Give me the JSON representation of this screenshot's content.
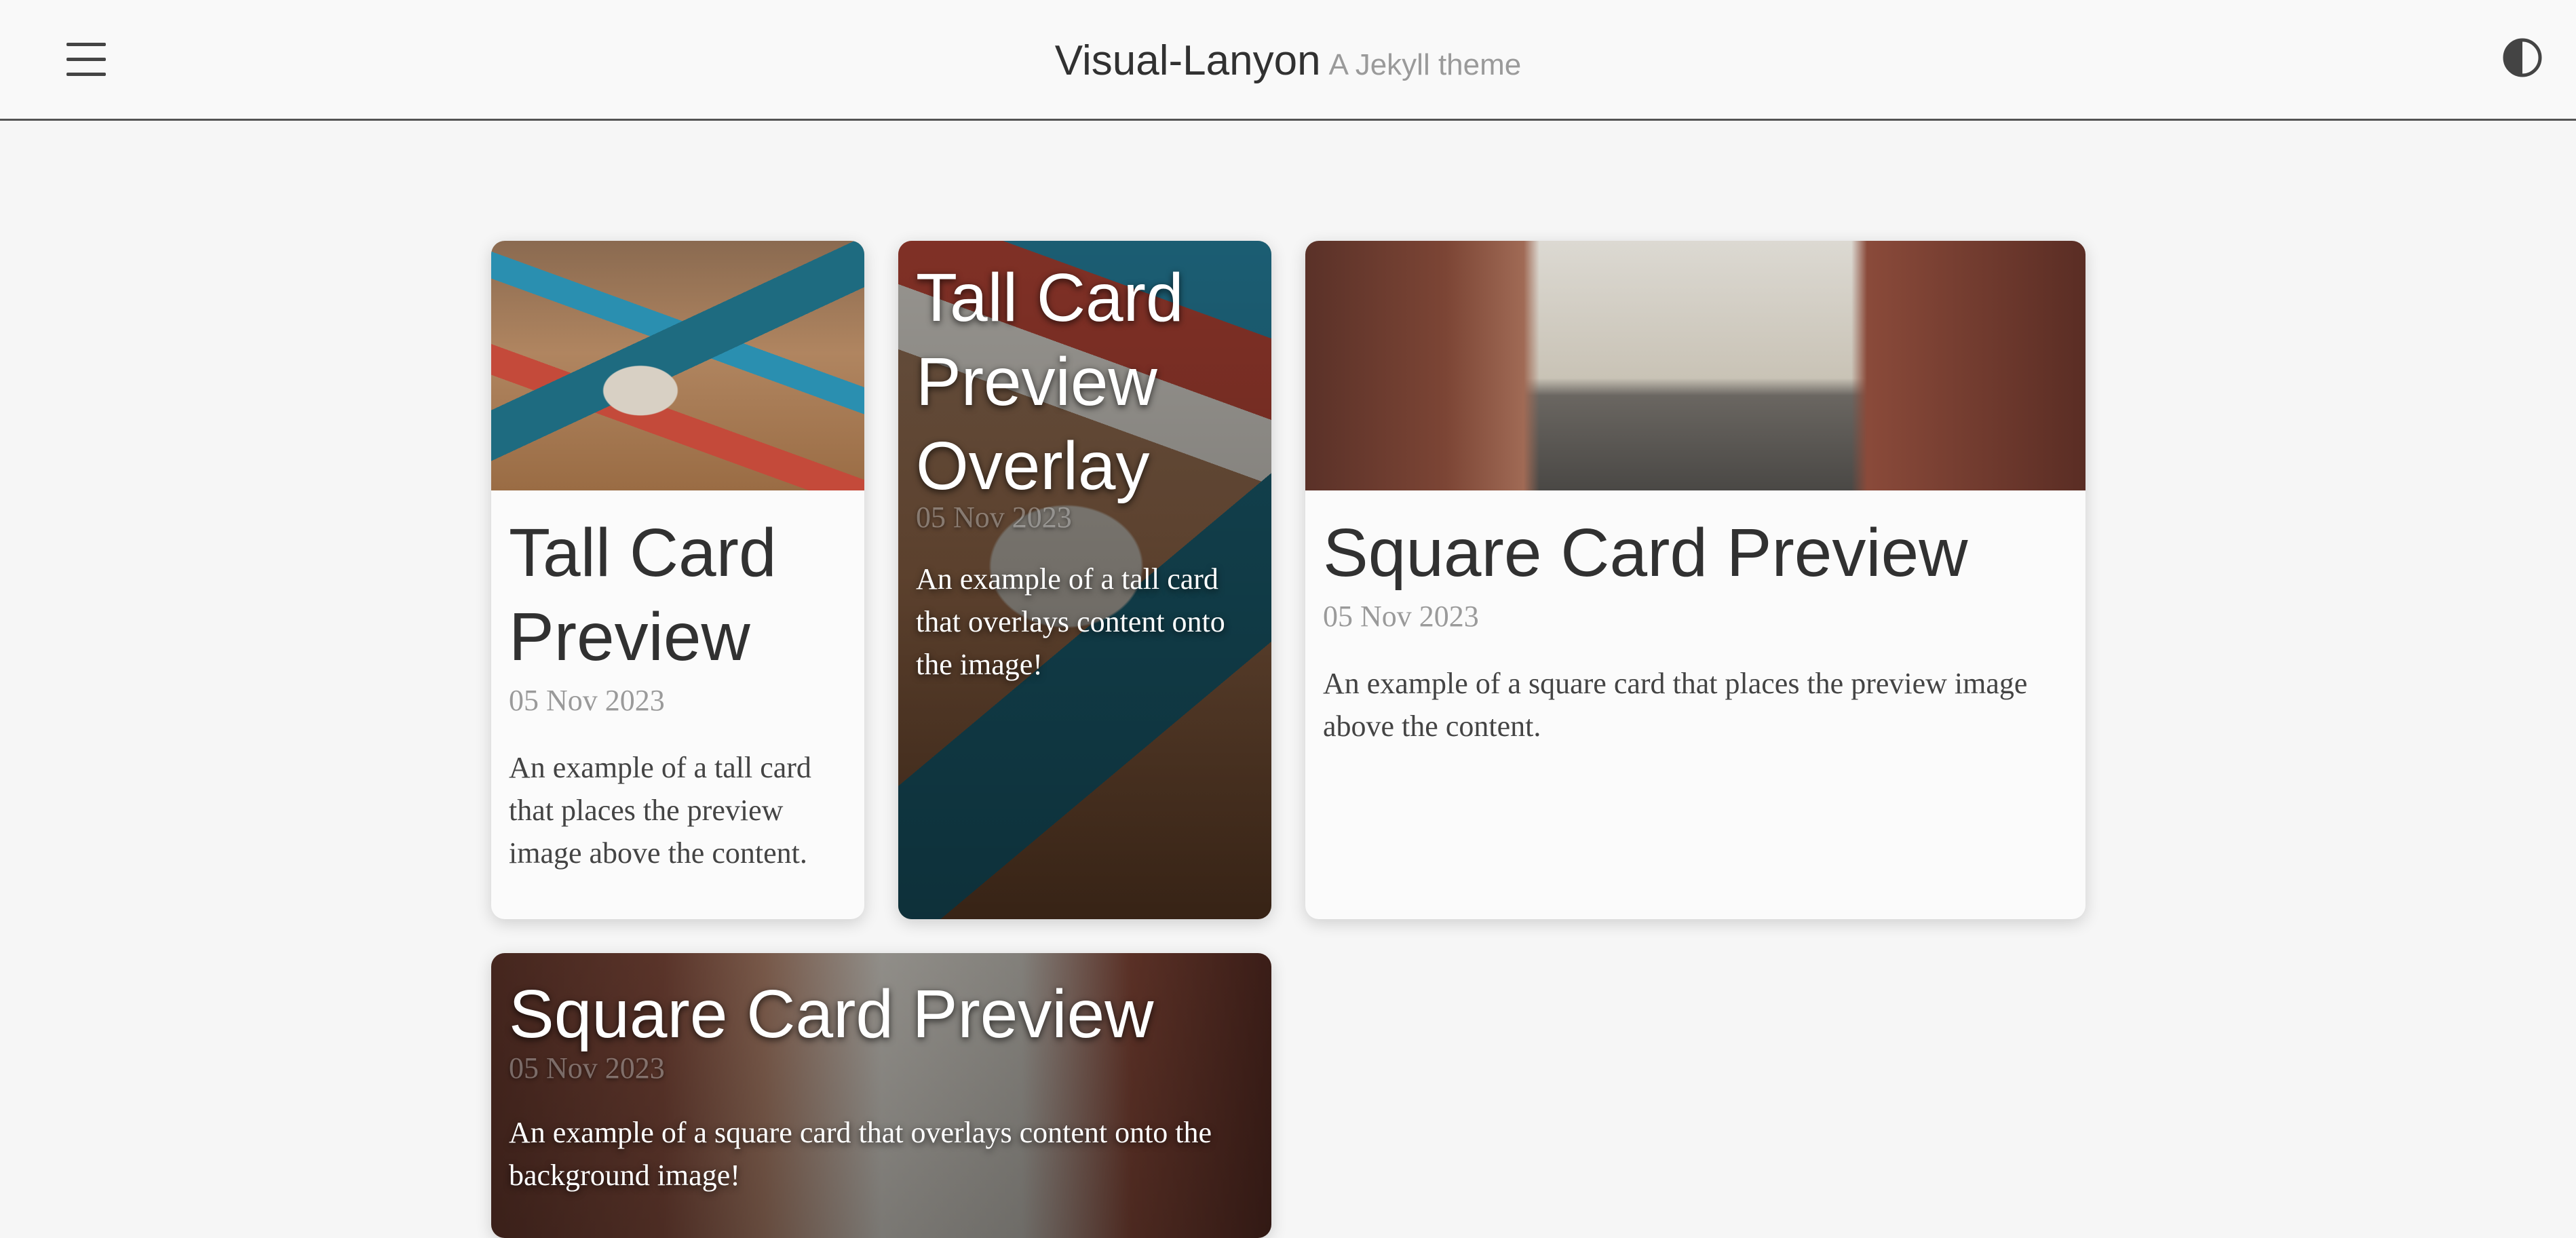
{
  "header": {
    "title": "Visual-Lanyon",
    "tagline": "A Jekyll theme",
    "menu_icon": "hamburger-menu-icon",
    "theme_icon": "contrast-toggle-icon"
  },
  "cards": [
    {
      "title": "Tall Card Preview",
      "date": "05 Nov 2023",
      "excerpt": "An example of a tall card that places the preview image above the content.",
      "style": "tall",
      "image": "letterpress-photo"
    },
    {
      "title": "Tall Card Preview Overlay",
      "date": "05 Nov 2023",
      "excerpt": "An example of a tall card that overlays content onto the image!",
      "style": "tall-overlay",
      "image": "letterpress-photo"
    },
    {
      "title": "Square Card Preview",
      "date": "05 Nov 2023",
      "excerpt": "An example of a square card that places the preview image above the content.",
      "style": "square",
      "image": "brick-alley-photo"
    },
    {
      "title": "Square Card Preview",
      "date": "05 Nov 2023",
      "excerpt": "An example of a square card that overlays content onto the background image!",
      "style": "square-overlay",
      "image": "brick-alley-photo"
    }
  ]
}
